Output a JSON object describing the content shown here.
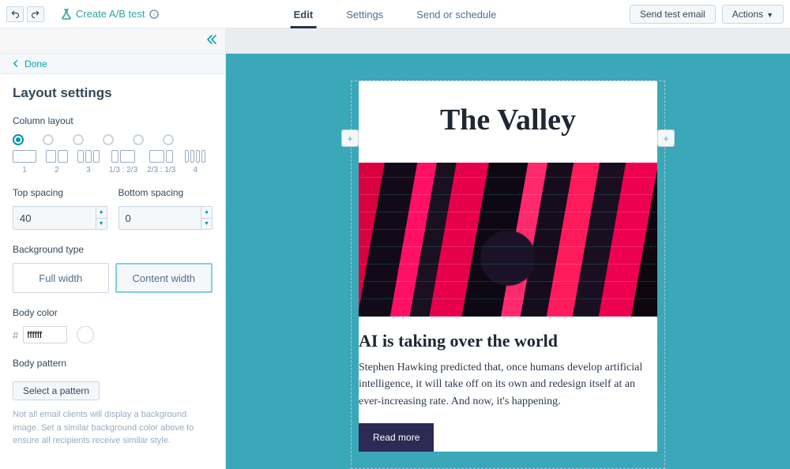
{
  "topbar": {
    "ab_test": "Create A/B test",
    "tabs": {
      "edit": "Edit",
      "settings": "Settings",
      "send": "Send or schedule"
    },
    "send_test": "Send test email",
    "actions": "Actions"
  },
  "sidebar": {
    "done": "Done",
    "title": "Layout settings",
    "column_layout_label": "Column layout",
    "col_labels": [
      "1",
      "2",
      "3",
      "1/3 : 2/3",
      "2/3 : 1/3",
      "4"
    ],
    "top_spacing_label": "Top spacing",
    "top_spacing_value": "40",
    "bottom_spacing_label": "Bottom spacing",
    "bottom_spacing_value": "0",
    "bg_type_label": "Background type",
    "bg_full": "Full width",
    "bg_content": "Content width",
    "body_color_label": "Body color",
    "body_color_value": "ffffff",
    "body_pattern_label": "Body pattern",
    "select_pattern": "Select a pattern",
    "hint": "Not all email clients will display a background image. Set a similar background color above to ensure all recipients receive similar style."
  },
  "email": {
    "masthead": "The Valley",
    "headline": "AI is taking over the world",
    "body": "Stephen Hawking predicted that, once humans develop artificial intelligence, it will take off on its own and redesign itself at an ever-increasing rate. And now, it's happening.",
    "cta": "Read more"
  }
}
